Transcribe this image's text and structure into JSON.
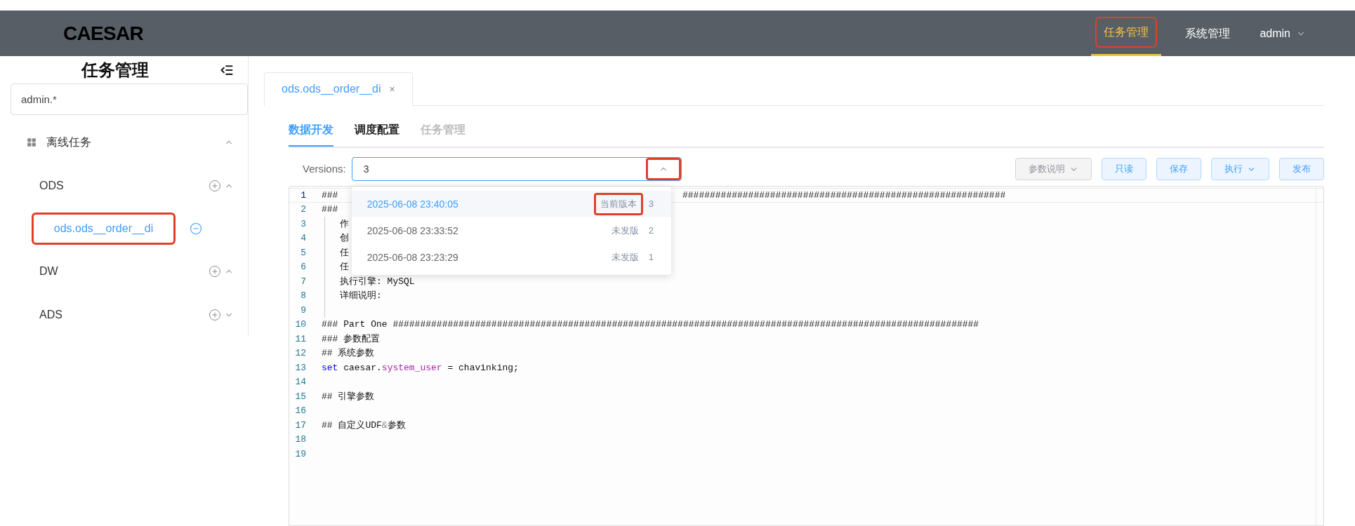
{
  "header": {
    "logo": "CAESAR",
    "nav": [
      {
        "label": "任务管理",
        "selected": true,
        "highlighted": true
      },
      {
        "label": "系统管理",
        "selected": false,
        "highlighted": false
      }
    ],
    "user": "admin"
  },
  "sidebar": {
    "title": "任务管理",
    "search": {
      "value": "admin.*"
    },
    "tree": [
      {
        "label": "离线任务",
        "expanded": true,
        "children": [
          {
            "label": "ODS",
            "expanded": true,
            "children": [
              {
                "label": "ods.ods__order__di",
                "selected": true,
                "highlighted": true
              }
            ]
          },
          {
            "label": "DW",
            "expanded": true
          },
          {
            "label": "ADS",
            "expanded": false
          }
        ]
      }
    ]
  },
  "tabs": [
    {
      "label": "ods.ods__order__di",
      "close": "×",
      "selected": true
    }
  ],
  "subtabs": [
    {
      "label": "数据开发",
      "selected": true,
      "disabled": false
    },
    {
      "label": "调度配置",
      "selected": false,
      "disabled": false
    },
    {
      "label": "任务管理",
      "selected": false,
      "disabled": true
    }
  ],
  "versions": {
    "label": "Versions:",
    "value": "3",
    "expanded": true,
    "caret_highlighted": true,
    "options": [
      {
        "time": "2025-06-08 23:40:05",
        "status": "当前版本",
        "number": "3",
        "selected": true,
        "highlighted": true
      },
      {
        "time": "2025-06-08 23:33:52",
        "status": "未发版",
        "number": "2",
        "selected": false,
        "highlighted": false
      },
      {
        "time": "2025-06-08 23:23:29",
        "status": "未发版",
        "number": "1",
        "selected": false,
        "highlighted": false
      }
    ]
  },
  "toolbar": [
    {
      "label": "参数说明",
      "dropdown": true,
      "disabled": true
    },
    {
      "label": "只读",
      "dropdown": false,
      "disabled": false
    },
    {
      "label": "保存",
      "dropdown": false,
      "disabled": false
    },
    {
      "label": "执行",
      "dropdown": true,
      "disabled": false
    },
    {
      "label": "发布",
      "dropdown": false,
      "disabled": false
    }
  ],
  "editor": {
    "lines": [
      {
        "number": "1",
        "active": true,
        "indent": false,
        "segments": [
          {
            "kind": "plain",
            "text": "### "
          }
        ],
        "after_popup": "###########################################################"
      },
      {
        "number": "2",
        "active": false,
        "indent": false,
        "segments": [
          {
            "kind": "plain",
            "text": "### "
          }
        ]
      },
      {
        "number": "3",
        "active": false,
        "indent": true,
        "segments": [
          {
            "kind": "plain",
            "text": "作"
          }
        ]
      },
      {
        "number": "4",
        "active": false,
        "indent": true,
        "segments": [
          {
            "kind": "plain",
            "text": "创"
          }
        ]
      },
      {
        "number": "5",
        "active": false,
        "indent": true,
        "segments": [
          {
            "kind": "plain",
            "text": "任"
          }
        ]
      },
      {
        "number": "6",
        "active": false,
        "indent": true,
        "segments": [
          {
            "kind": "plain",
            "text": "任"
          }
        ]
      },
      {
        "number": "7",
        "active": false,
        "indent": true,
        "segments": [
          {
            "kind": "plain",
            "text": "执行引擎: MySQL"
          }
        ]
      },
      {
        "number": "8",
        "active": false,
        "indent": true,
        "segments": [
          {
            "kind": "plain",
            "text": "详细说明:"
          }
        ]
      },
      {
        "number": "9",
        "active": false,
        "indent": true
      },
      {
        "number": "10",
        "active": false,
        "indent": false,
        "segments": [
          {
            "kind": "plain",
            "text": "### Part One ###########################################################################################################"
          }
        ]
      },
      {
        "number": "11",
        "active": false,
        "indent": false,
        "segments": [
          {
            "kind": "plain",
            "text": "### 参数配置"
          }
        ]
      },
      {
        "number": "12",
        "active": false,
        "indent": false,
        "segments": [
          {
            "kind": "plain",
            "text": "## 系统参数"
          }
        ]
      },
      {
        "number": "13",
        "active": false,
        "indent": false,
        "segments": [
          {
            "kind": "keyword",
            "text": "set"
          },
          {
            "kind": "plain",
            "text": " caesar."
          },
          {
            "kind": "property",
            "text": "system_user"
          },
          {
            "kind": "plain",
            "text": " = chavinking;"
          }
        ]
      },
      {
        "number": "14",
        "active": false,
        "indent": false
      },
      {
        "number": "15",
        "active": false,
        "indent": false,
        "segments": [
          {
            "kind": "plain",
            "text": "## 引擎参数"
          }
        ]
      },
      {
        "number": "16",
        "active": false,
        "indent": false
      },
      {
        "number": "17",
        "active": false,
        "indent": false,
        "segments": [
          {
            "kind": "plain",
            "text": "## 自定义UDF"
          },
          {
            "kind": "operator",
            "text": "&"
          },
          {
            "kind": "plain",
            "text": "参数"
          }
        ]
      },
      {
        "number": "18",
        "active": false,
        "indent": false
      },
      {
        "number": "19",
        "active": false,
        "indent": false
      }
    ]
  }
}
